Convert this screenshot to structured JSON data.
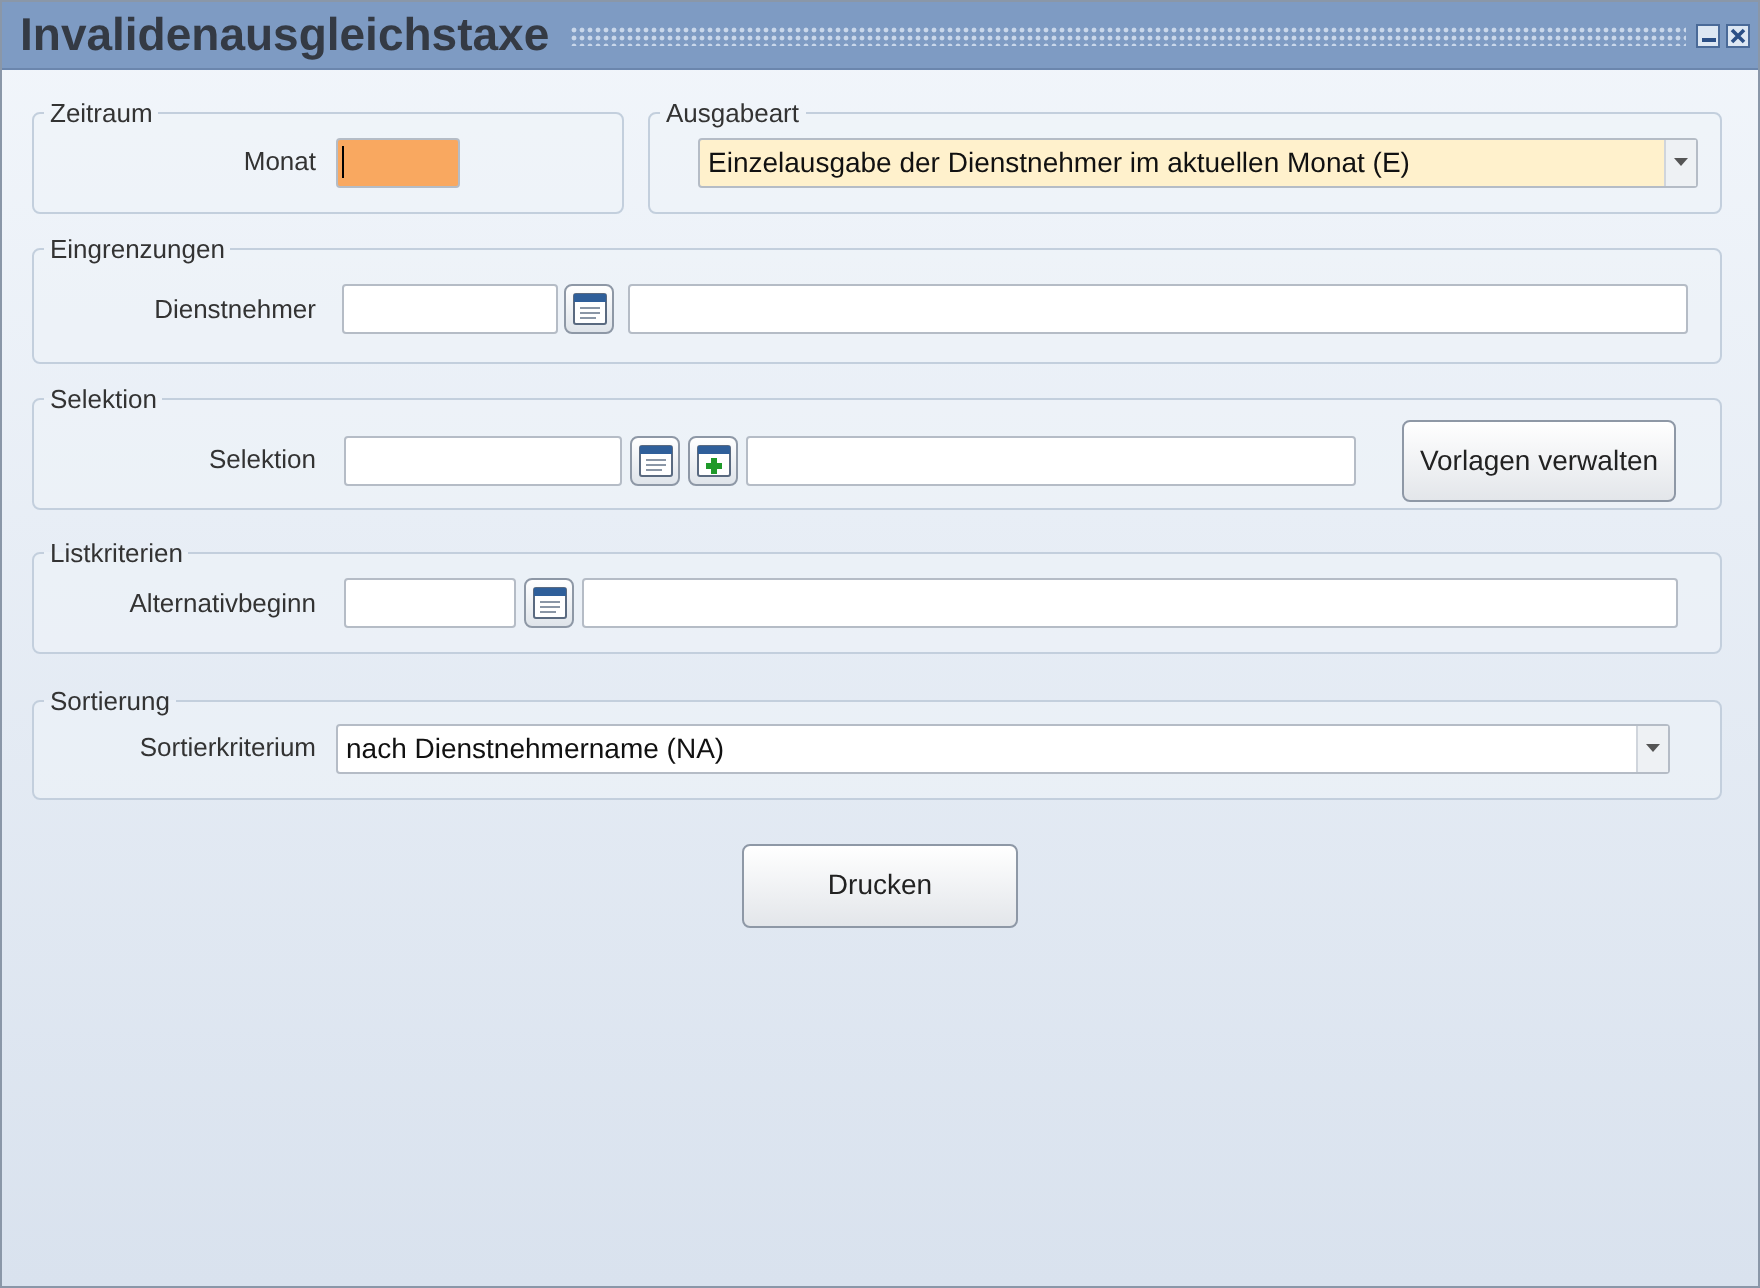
{
  "window": {
    "title": "Invalidenausgleichstaxe"
  },
  "zeitraum": {
    "legend": "Zeitraum",
    "label": "Monat",
    "focused": true
  },
  "ausgabeart": {
    "legend": "Ausgabeart",
    "value": "Einzelausgabe der Dienstnehmer im aktuellen Monat (E)"
  },
  "eingrenzungen": {
    "legend": "Eingrenzungen",
    "label": "Dienstnehmer"
  },
  "selektion": {
    "legend": "Selektion",
    "label": "Selektion",
    "button": "Vorlagen verwalten"
  },
  "listkriterien": {
    "legend": "Listkriterien",
    "label": "Alternativbeginn"
  },
  "sortierung": {
    "legend": "Sortierung",
    "label": "Sortierkriterium",
    "value": "nach Dienstnehmername (NA)"
  },
  "print_button": "Drucken"
}
